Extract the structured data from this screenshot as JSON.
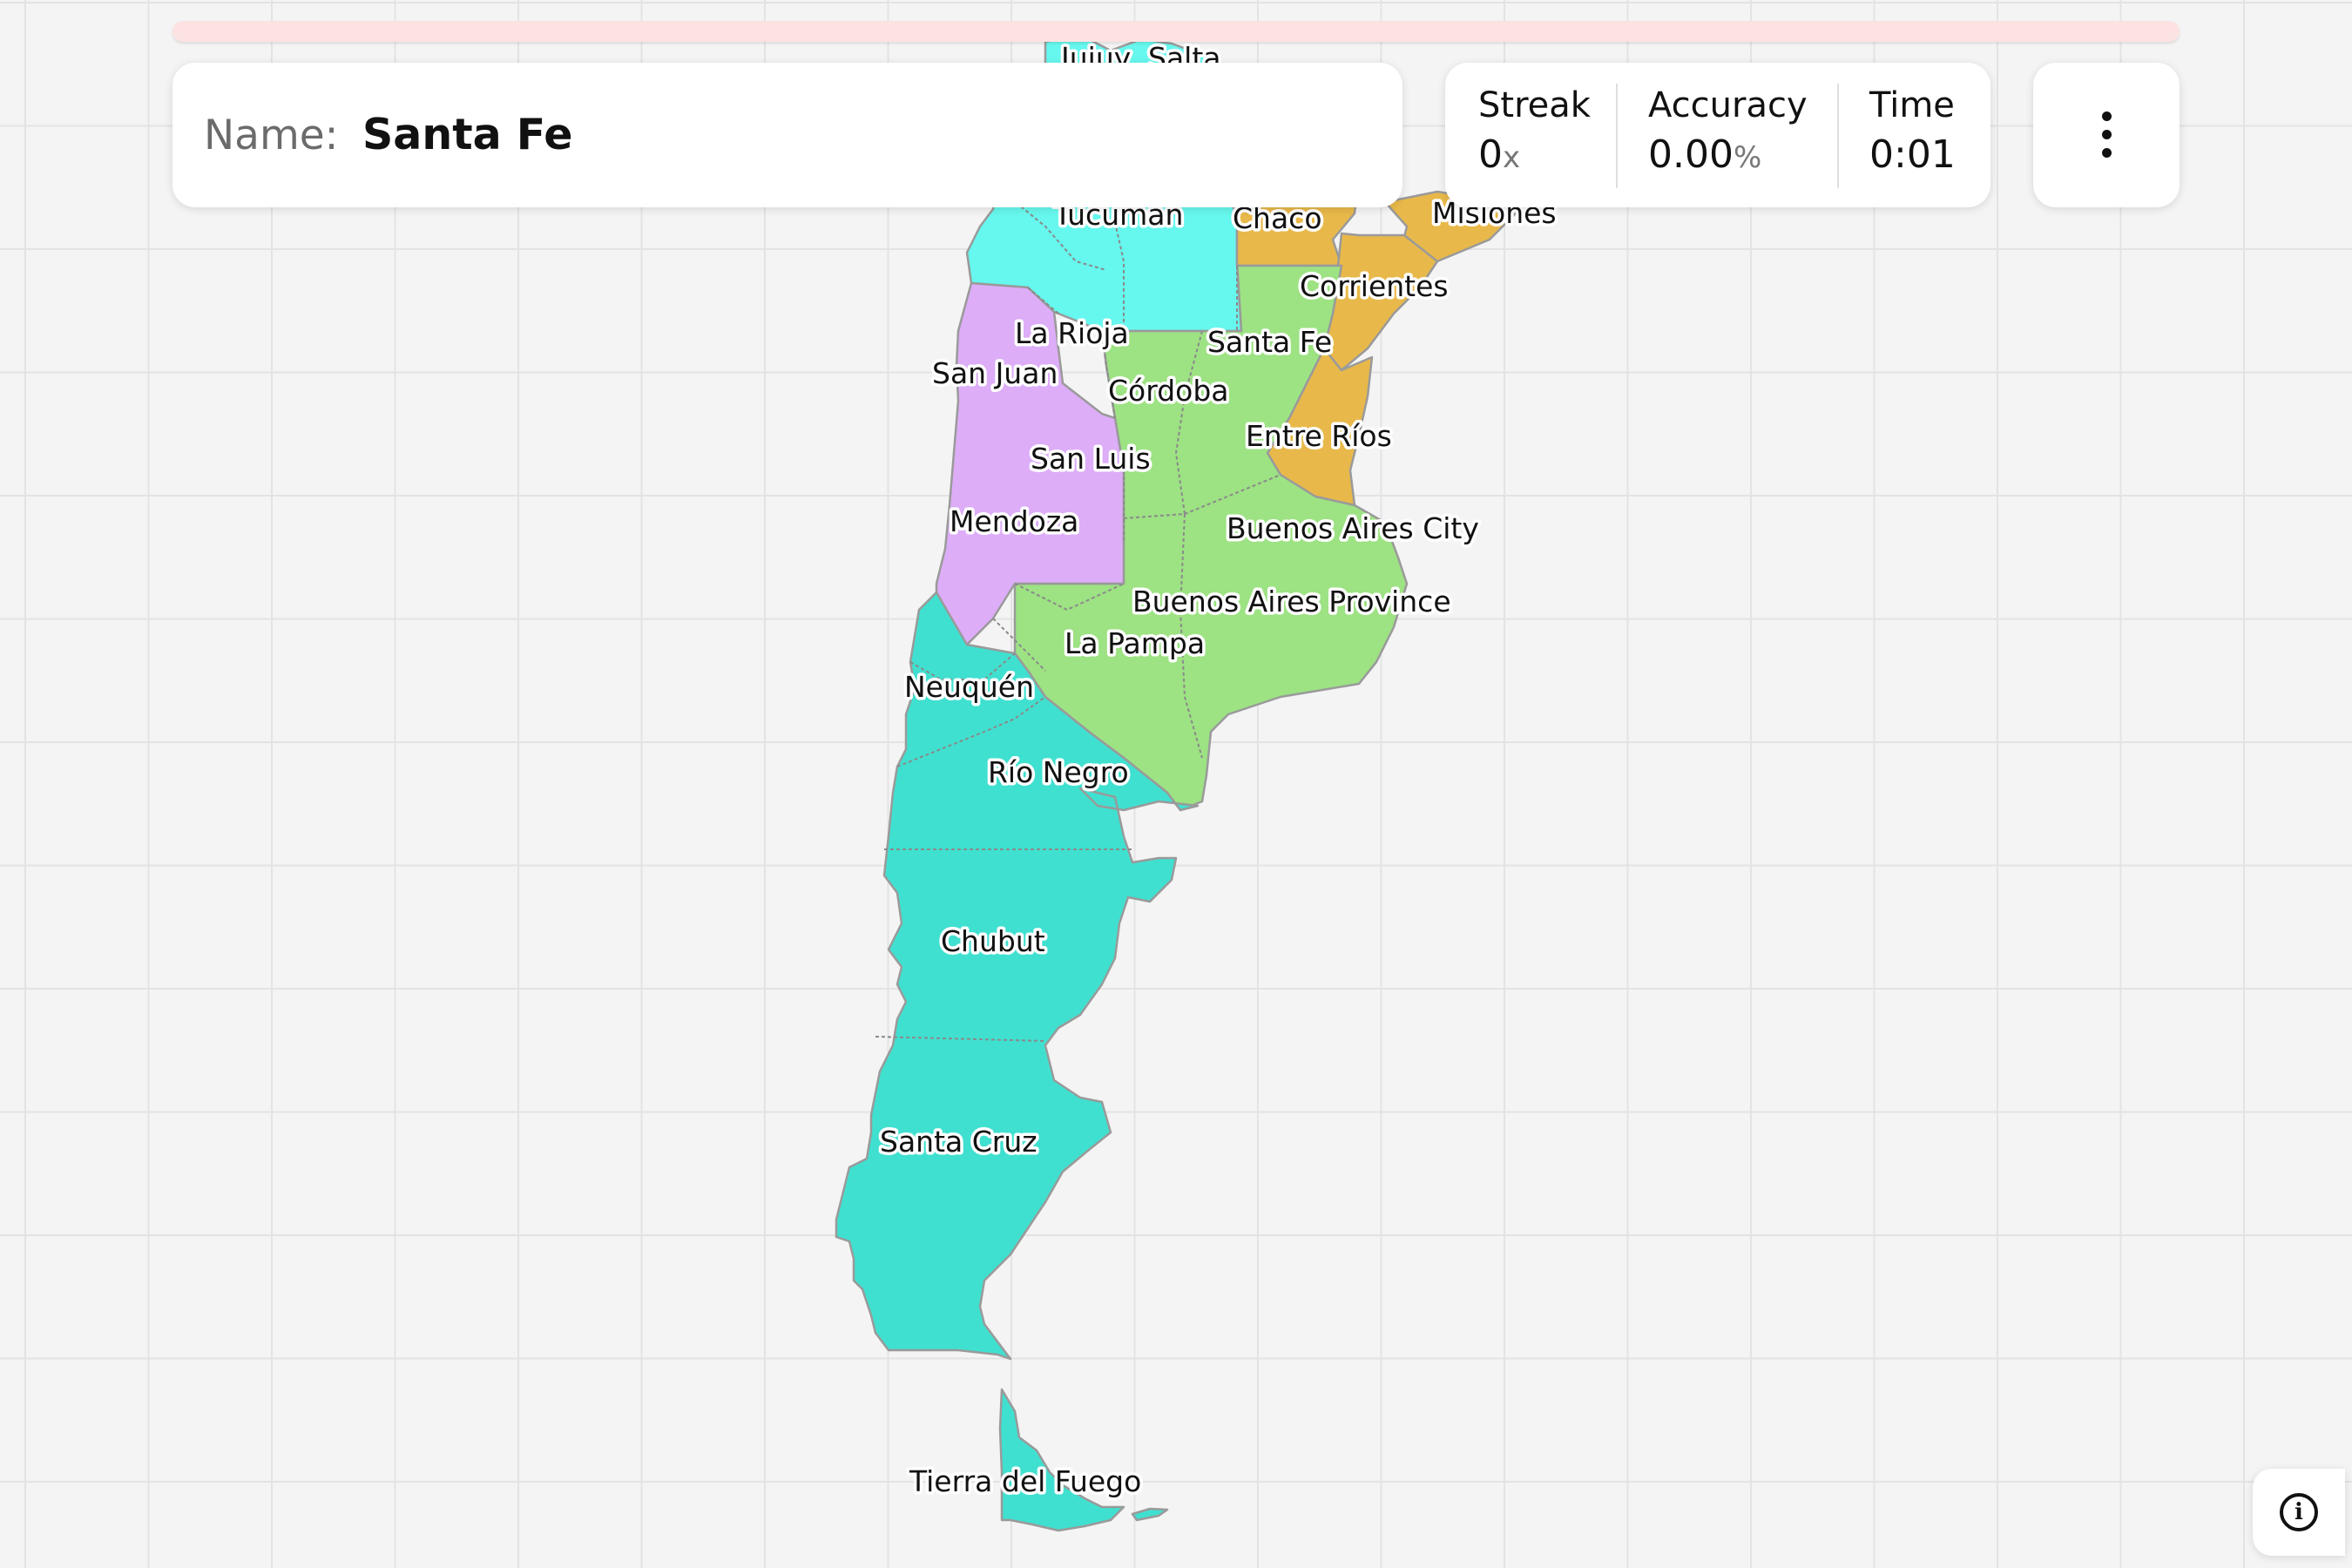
{
  "colors": {
    "teal": "#40e0d0",
    "cyan": "#66f7ee",
    "green": "#9de283",
    "purple": "#ddadf8",
    "orange": "#e8b94a",
    "progress_track": "#fde2e2",
    "background": "#f4f4f4"
  },
  "header": {
    "name_label": "Name:",
    "name_value": "Santa Fe"
  },
  "stats": {
    "streak_label": "Streak",
    "streak_value": "0",
    "streak_unit": "x",
    "accuracy_label": "Accuracy",
    "accuracy_value": "0.00",
    "accuracy_unit": "%",
    "time_label": "Time",
    "time_value": "0:01"
  },
  "icons": {
    "menu": "more-vertical-icon",
    "info": "info-icon"
  },
  "progress": {
    "fraction": 0
  },
  "map": {
    "provinces": [
      {
        "key": "jujuy",
        "name": "Jujuy"
      },
      {
        "key": "salta",
        "name": "Salta"
      },
      {
        "key": "tucuman",
        "name": "Tucumán"
      },
      {
        "key": "chaco",
        "name": "Chaco"
      },
      {
        "key": "misiones",
        "name": "Misiones"
      },
      {
        "key": "corrientes",
        "name": "Corrientes"
      },
      {
        "key": "la_rioja",
        "name": "La Rioja"
      },
      {
        "key": "santa_fe",
        "name": "Santa Fe"
      },
      {
        "key": "san_juan",
        "name": "San Juan"
      },
      {
        "key": "cordoba",
        "name": "Córdoba"
      },
      {
        "key": "entre_rios",
        "name": "Entre Ríos"
      },
      {
        "key": "san_luis",
        "name": "San Luis"
      },
      {
        "key": "mendoza",
        "name": "Mendoza"
      },
      {
        "key": "buenos_aires_city",
        "name": "Buenos Aires City"
      },
      {
        "key": "buenos_aires_province",
        "name": "Buenos Aires Province"
      },
      {
        "key": "la_pampa",
        "name": "La Pampa"
      },
      {
        "key": "neuquen",
        "name": "Neuquén"
      },
      {
        "key": "rio_negro",
        "name": "Río Negro"
      },
      {
        "key": "chubut",
        "name": "Chubut"
      },
      {
        "key": "santa_cruz",
        "name": "Santa Cruz"
      },
      {
        "key": "tierra_del_fuego",
        "name": "Tierra del Fuego"
      }
    ]
  }
}
